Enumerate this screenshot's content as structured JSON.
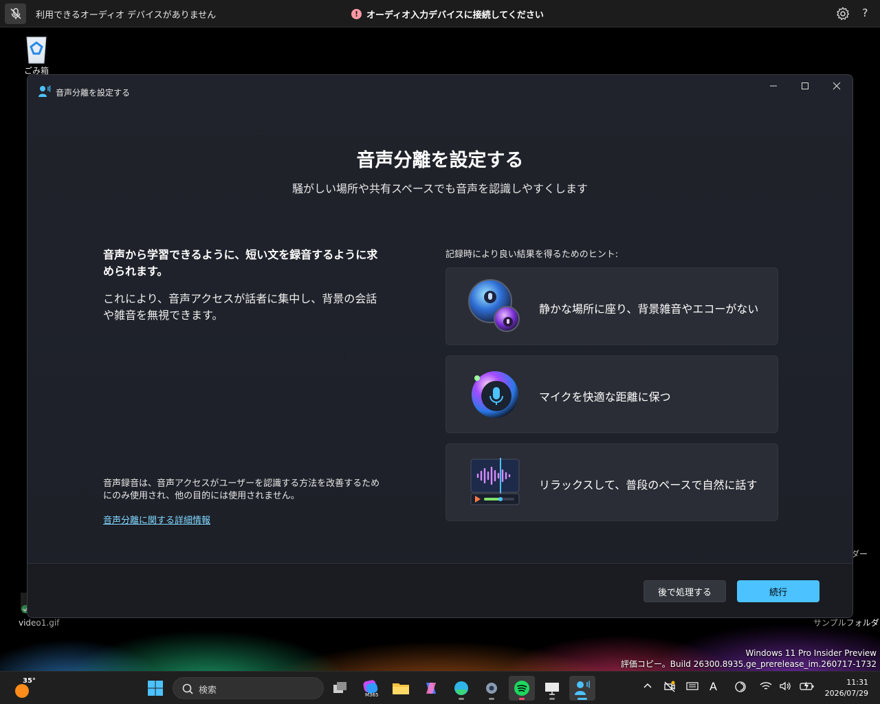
{
  "voice_access_bar": {
    "status": "利用できるオーディオ デバイスがありません",
    "alert": "オーディオ入力デバイスに接続してください",
    "alert_icon": "!",
    "help": "?"
  },
  "desktop": {
    "recycle_bin": "ごみ箱",
    "video_file": "video1.gif",
    "sample_folder": "サンプルフォルダ",
    "partial_label": "ダー"
  },
  "window": {
    "title": "音声分離を設定する",
    "heading": "音声分離を設定する",
    "subheading": "騒がしい場所や共有スペースでも音声を認識しやすくします",
    "lead": "音声から学習できるように、短い文を録音するように求められます。",
    "body": "これにより、音声アクセスが話者に集中し、背景の会話や雑音を無視できます。",
    "privacy": "音声録音は、音声アクセスがユーザーを認識する方法を改善するためにのみ使用され、他の目的には使用されません。",
    "learn_more": "音声分離に関する詳細情報",
    "tips_label": "記録時により良い結果を得るためのヒント:",
    "tips": [
      {
        "text": "静かな場所に座り、背景雑音やエコーがない",
        "icon": "voices-bubbles-icon"
      },
      {
        "text": "マイクを快適な距離に保つ",
        "icon": "microphone-orb-icon"
      },
      {
        "text": "リラックスして、普段のペースで自然に話す",
        "icon": "audio-waveform-icon"
      }
    ],
    "later_button": "後で処理する",
    "continue_button": "続行"
  },
  "watermark": {
    "line1": "Windows 11 Pro Insider Preview",
    "line2": "評価コピー。Build 26300.8935.ge_prerelease_im.260717-1732"
  },
  "taskbar": {
    "weather_temp": "35°",
    "search_placeholder": "検索",
    "m365_label": "M365",
    "ime_mode": "A",
    "time": "11:31",
    "date": "2026/07/29"
  },
  "colors": {
    "accent": "#4cc2ff",
    "link": "#80d8ff",
    "alert": "#ff99a4"
  }
}
